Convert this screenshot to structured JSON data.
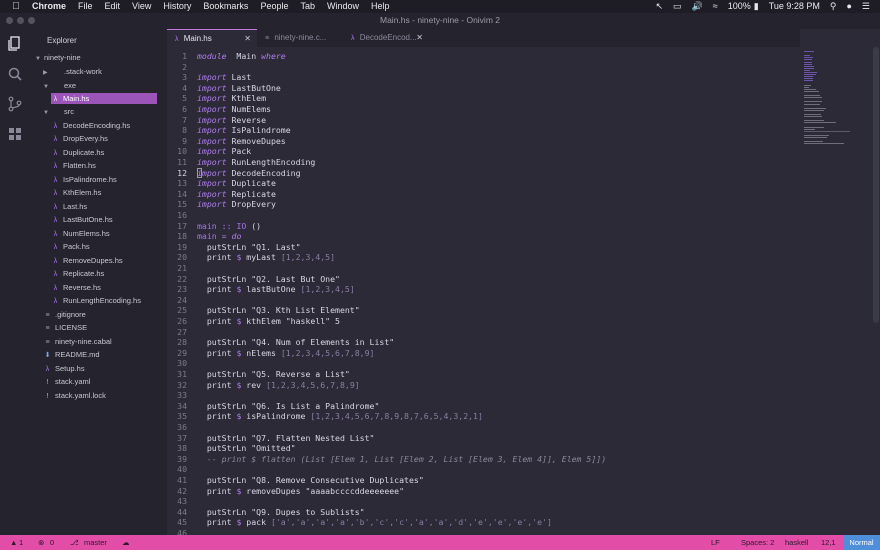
{
  "menubar": {
    "app": "Chrome",
    "items": [
      "File",
      "Edit",
      "View",
      "History",
      "Bookmarks",
      "People",
      "Tab",
      "Window",
      "Help"
    ],
    "battery": "100%",
    "clock": "Tue 9:28 PM"
  },
  "window": {
    "title": "Main.hs - ninety-nine - Onivim 2"
  },
  "explorer": {
    "title": "Explorer",
    "root": "ninety-nine",
    "items": [
      {
        "label": ".stack-work",
        "type": "folder",
        "open": false
      },
      {
        "label": "exe",
        "type": "folder",
        "open": true
      },
      {
        "label": "Main.hs",
        "type": "hs",
        "selected": true
      },
      {
        "label": "src",
        "type": "folder",
        "open": true
      },
      {
        "label": "DecodeEncoding.hs",
        "type": "hs"
      },
      {
        "label": "DropEvery.hs",
        "type": "hs"
      },
      {
        "label": "Duplicate.hs",
        "type": "hs"
      },
      {
        "label": "Flatten.hs",
        "type": "hs"
      },
      {
        "label": "IsPalindrome.hs",
        "type": "hs"
      },
      {
        "label": "KthElem.hs",
        "type": "hs"
      },
      {
        "label": "Last.hs",
        "type": "hs"
      },
      {
        "label": "LastButOne.hs",
        "type": "hs"
      },
      {
        "label": "NumElems.hs",
        "type": "hs"
      },
      {
        "label": "Pack.hs",
        "type": "hs"
      },
      {
        "label": "RemoveDupes.hs",
        "type": "hs"
      },
      {
        "label": "Replicate.hs",
        "type": "hs"
      },
      {
        "label": "Reverse.hs",
        "type": "hs"
      },
      {
        "label": "RunLengthEncoding.hs",
        "type": "hs"
      },
      {
        "label": ".gitignore",
        "type": "file"
      },
      {
        "label": "LICENSE",
        "type": "file"
      },
      {
        "label": "ninety-nine.cabal",
        "type": "file"
      },
      {
        "label": "README.md",
        "type": "md"
      },
      {
        "label": "Setup.hs",
        "type": "hs"
      },
      {
        "label": "stack.yaml",
        "type": "yaml"
      },
      {
        "label": "stack.yaml.lock",
        "type": "yaml"
      }
    ]
  },
  "tabs": [
    {
      "label": "Main.hs",
      "active": true
    },
    {
      "label": "ninety-nine.c...",
      "active": false
    },
    {
      "label": "DecodeEncod...",
      "active": false
    }
  ],
  "editor": {
    "current_line": 12,
    "lines": [
      [
        [
          "kw",
          "module"
        ],
        [
          "",
          "  Main "
        ],
        [
          "kw",
          "where"
        ]
      ],
      [],
      [
        [
          "kw",
          "import"
        ],
        [
          "",
          " Last"
        ]
      ],
      [
        [
          "kw",
          "import"
        ],
        [
          "",
          " LastButOne"
        ]
      ],
      [
        [
          "kw",
          "import"
        ],
        [
          "",
          " KthElem"
        ]
      ],
      [
        [
          "kw",
          "import"
        ],
        [
          "",
          " NumElems"
        ]
      ],
      [
        [
          "kw",
          "import"
        ],
        [
          "",
          " Reverse"
        ]
      ],
      [
        [
          "kw",
          "import"
        ],
        [
          "",
          " IsPalindrome"
        ]
      ],
      [
        [
          "kw",
          "import"
        ],
        [
          "",
          " RemoveDupes"
        ]
      ],
      [
        [
          "kw",
          "import"
        ],
        [
          "",
          " Pack"
        ]
      ],
      [
        [
          "kw",
          "import"
        ],
        [
          "",
          " RunLengthEncoding"
        ]
      ],
      [
        [
          "kw",
          "import"
        ],
        [
          "",
          " DecodeEncoding"
        ]
      ],
      [
        [
          "kw",
          "import"
        ],
        [
          "",
          " Duplicate"
        ]
      ],
      [
        [
          "kw",
          "import"
        ],
        [
          "",
          " Replicate"
        ]
      ],
      [
        [
          "kw",
          "import"
        ],
        [
          "",
          " DropEvery"
        ]
      ],
      [],
      [
        [
          "ty",
          "main"
        ],
        [
          "",
          " "
        ],
        [
          "op",
          "::"
        ],
        [
          "",
          " "
        ],
        [
          "ty",
          "IO"
        ],
        [
          "",
          " ()"
        ]
      ],
      [
        [
          "ty",
          "main"
        ],
        [
          "",
          " "
        ],
        [
          "op",
          "="
        ],
        [
          "",
          " "
        ],
        [
          "kw",
          "do"
        ]
      ],
      [
        [
          "",
          "  putStrLn \"Q1. Last\""
        ]
      ],
      [
        [
          "",
          "  print "
        ],
        [
          "op",
          "$"
        ],
        [
          "",
          " myLast "
        ],
        [
          "list",
          "[1,2,3,4,5]"
        ]
      ],
      [],
      [
        [
          "",
          "  putStrLn \"Q2. Last But One\""
        ]
      ],
      [
        [
          "",
          "  print "
        ],
        [
          "op",
          "$"
        ],
        [
          "",
          " lastButOne "
        ],
        [
          "list",
          "[1,2,3,4,5]"
        ]
      ],
      [],
      [
        [
          "",
          "  putStrLn \"Q3. Kth List Element\""
        ]
      ],
      [
        [
          "",
          "  print "
        ],
        [
          "op",
          "$"
        ],
        [
          "",
          " kthElem \"haskell\" 5"
        ]
      ],
      [],
      [
        [
          "",
          "  putStrLn \"Q4. Num of Elements in List\""
        ]
      ],
      [
        [
          "",
          "  print "
        ],
        [
          "op",
          "$"
        ],
        [
          "",
          " nElems "
        ],
        [
          "list",
          "[1,2,3,4,5,6,7,8,9]"
        ]
      ],
      [],
      [
        [
          "",
          "  putStrLn \"Q5. Reverse a List\""
        ]
      ],
      [
        [
          "",
          "  print "
        ],
        [
          "op",
          "$"
        ],
        [
          "",
          " rev "
        ],
        [
          "list",
          "[1,2,3,4,5,6,7,8,9]"
        ]
      ],
      [],
      [
        [
          "",
          "  putStrLn \"Q6. Is List a Palindrome\""
        ]
      ],
      [
        [
          "",
          "  print "
        ],
        [
          "op",
          "$"
        ],
        [
          "",
          " isPalindrome "
        ],
        [
          "list",
          "[1,2,3,4,5,6,7,8,9,8,7,6,5,4,3,2,1]"
        ]
      ],
      [],
      [
        [
          "",
          "  putStrLn \"Q7. Flatten Nested List\""
        ]
      ],
      [
        [
          "",
          "  putStrLn \"Omitted\""
        ]
      ],
      [
        [
          "cmt",
          "  -- print $ flatten (List [Elem 1, List [Elem 2, List [Elem 3, Elem 4]], Elem 5]])"
        ]
      ],
      [],
      [
        [
          "",
          "  putStrLn \"Q8. Remove Consecutive Duplicates\""
        ]
      ],
      [
        [
          "",
          "  print "
        ],
        [
          "op",
          "$"
        ],
        [
          "",
          " removeDupes \"aaaabccccddeeeeeee\""
        ]
      ],
      [],
      [
        [
          "",
          "  putStrLn \"Q9. Dupes to Sublists\""
        ]
      ],
      [
        [
          "",
          "  print "
        ],
        [
          "op",
          "$"
        ],
        [
          "",
          " pack "
        ],
        [
          "list",
          "['a','a','a','a','b','c','c','a','a','d','e','e','e','e']"
        ]
      ],
      [
        [
          "",
          ""
        ]
      ]
    ]
  },
  "statusbar": {
    "errors": "1",
    "warnings": "0",
    "branch": "master",
    "eol": "LF",
    "spaces": "Spaces: 2",
    "language": "haskell",
    "position": "12,1",
    "mode": "Normal"
  }
}
